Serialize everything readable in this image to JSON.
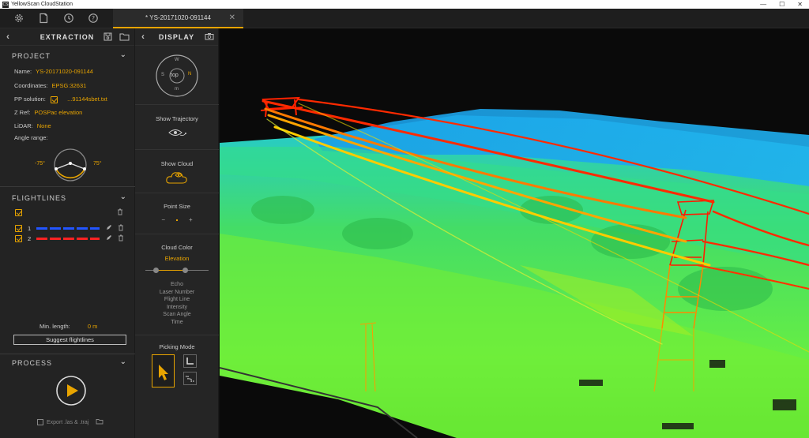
{
  "app": {
    "title": "YellowScan CloudStation",
    "logo_text": "CS"
  },
  "window_controls": {
    "minimize": "—",
    "maximize": "☐",
    "close": "✕"
  },
  "toolbar": {
    "tab_title": "* YS-20171020-091144",
    "tab_close": "✕"
  },
  "extraction": {
    "header": "EXTRACTION",
    "project": {
      "section_title": "PROJECT",
      "name_label": "Name:",
      "name_value": "YS-20171020-091144",
      "coords_label": "Coordinates:",
      "coords_value": "EPSG:32631",
      "pp_label": "PP solution:",
      "pp_value": "...91144sbet.txt",
      "zref_label": "Z Ref:",
      "zref_value": "POSPac elevation",
      "lidar_label": "LiDAR:",
      "lidar_value": "None",
      "angle_label": "Angle range:",
      "angle_min": "-75°",
      "angle_max": "75°"
    },
    "flightlines": {
      "section_title": "FLIGHTLINES",
      "items": [
        {
          "num": "1",
          "color": "#2255ff"
        },
        {
          "num": "2",
          "color": "#ff2222"
        }
      ],
      "min_length_label": "Min. length:",
      "min_length_value": "0 m",
      "suggest_button": "Suggest flightlines"
    },
    "process": {
      "section_title": "PROCESS",
      "export_label": "Export .las & .traj"
    }
  },
  "display": {
    "header": "DISPLAY",
    "compass": {
      "top": "top",
      "n": "N",
      "s": "S",
      "e": "E",
      "w": "W",
      "m": "m"
    },
    "show_trajectory": "Show Trajectory",
    "show_cloud": "Show Cloud",
    "point_size": "Point Size",
    "point_size_minus": "−",
    "point_size_plus": "+",
    "cloud_color": "Cloud Color",
    "cloud_color_value": "Elevation",
    "color_options": [
      "Echo",
      "Laser Number",
      "Flight Line",
      "Intensity",
      "Scan Angle",
      "Time"
    ],
    "picking_mode": "Picking Mode"
  },
  "accent_color": "#e8a400"
}
